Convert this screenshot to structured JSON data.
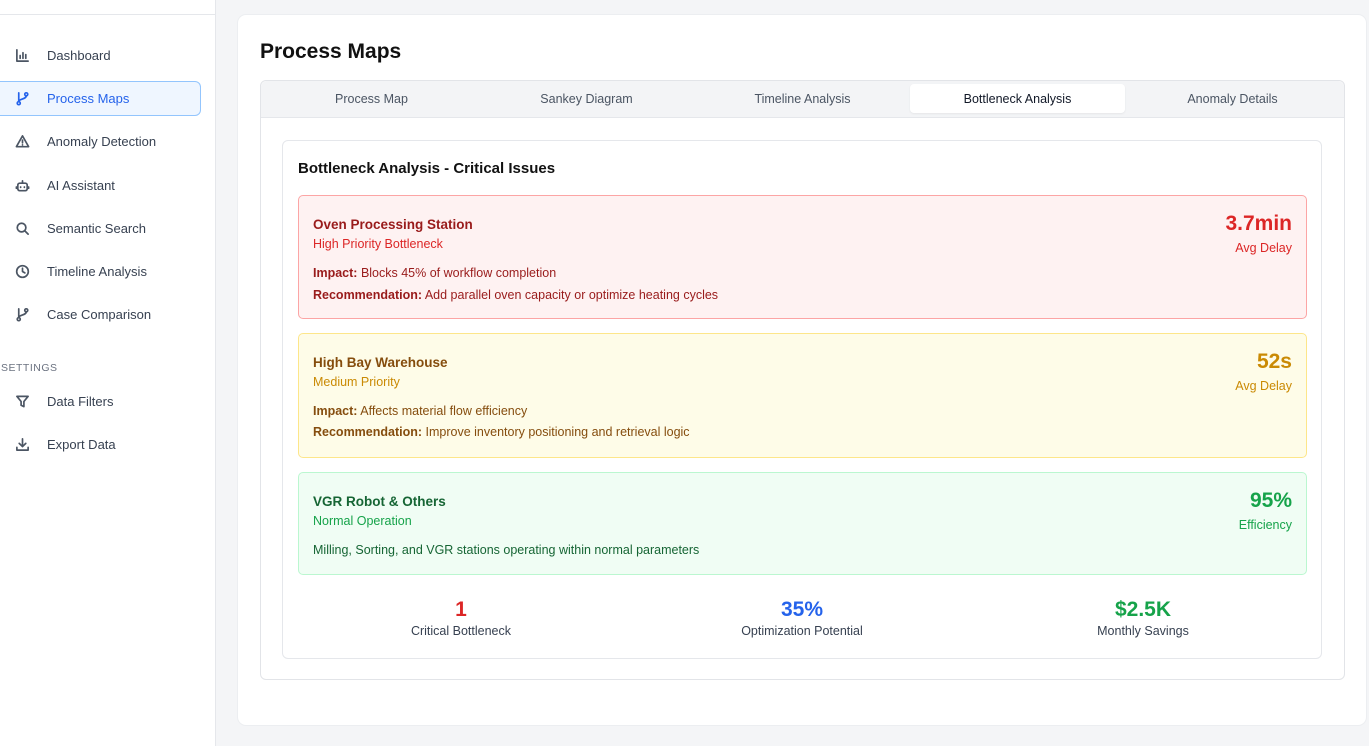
{
  "sidebar": {
    "items": [
      {
        "label": "Dashboard",
        "icon": "bar-chart-icon"
      },
      {
        "label": "Process Maps",
        "icon": "git-branch-icon",
        "active": true
      },
      {
        "label": "Anomaly Detection",
        "icon": "warning-triangle-icon"
      },
      {
        "label": "AI Assistant",
        "icon": "robot-icon"
      },
      {
        "label": "Semantic Search",
        "icon": "search-icon"
      },
      {
        "label": "Timeline Analysis",
        "icon": "clock-icon"
      },
      {
        "label": "Case Comparison",
        "icon": "git-branch-icon"
      }
    ],
    "settings_heading": "SETTINGS",
    "settings_items": [
      {
        "label": "Data Filters",
        "icon": "filter-icon"
      },
      {
        "label": "Export Data",
        "icon": "download-icon"
      }
    ]
  },
  "main": {
    "title": "Process Maps",
    "tabs": [
      {
        "label": "Process Map"
      },
      {
        "label": "Sankey Diagram"
      },
      {
        "label": "Timeline Analysis"
      },
      {
        "label": "Bottleneck Analysis",
        "active": true
      },
      {
        "label": "Anomaly Details"
      }
    ],
    "analysis": {
      "title": "Bottleneck Analysis - Critical Issues",
      "issues": [
        {
          "name": "Oven Processing Station",
          "priority": "High Priority Bottleneck",
          "impact_label": "Impact:",
          "impact": "Blocks 45% of workflow completion",
          "recommendation_label": "Recommendation:",
          "recommendation": "Add parallel oven capacity or optimize heating cycles",
          "value": "3.7min",
          "value_label": "Avg Delay",
          "color": "#dc2626"
        },
        {
          "name": "High Bay Warehouse",
          "priority": "Medium Priority",
          "impact_label": "Impact:",
          "impact": "Affects material flow efficiency",
          "recommendation_label": "Recommendation:",
          "recommendation": "Improve inventory positioning and retrieval logic",
          "value": "52s",
          "value_label": "Avg Delay",
          "color": "#ca8a04"
        },
        {
          "name": "VGR Robot & Others",
          "priority": "Normal Operation",
          "description": "Milling, Sorting, and VGR stations operating within normal parameters",
          "value": "95%",
          "value_label": "Efficiency",
          "color": "#16a34a"
        }
      ],
      "stats": [
        {
          "value": "1",
          "label": "Critical Bottleneck",
          "color": "#dc2626"
        },
        {
          "value": "35%",
          "label": "Optimization Potential",
          "color": "#2563eb"
        },
        {
          "value": "$2.5K",
          "label": "Monthly Savings",
          "color": "#16a34a"
        }
      ]
    }
  }
}
